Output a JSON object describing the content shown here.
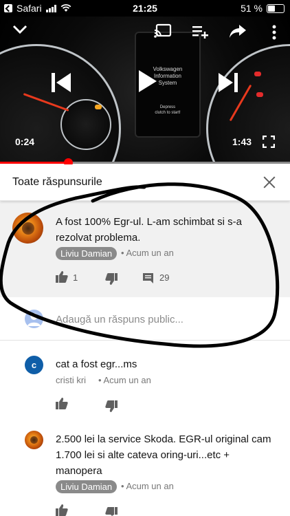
{
  "status_bar": {
    "back_app": "Safari",
    "time": "21:25",
    "battery": "51 %",
    "battery_level": 0.51
  },
  "video": {
    "current_time": "0:24",
    "duration": "1:43",
    "progress": 0.235,
    "screen_text": [
      "Volkswagen",
      "Information",
      "System"
    ],
    "screen_subtext": [
      "Depress",
      "clutch to start!"
    ]
  },
  "replies_panel": {
    "title": "Toate răspunsurile"
  },
  "parent_comment": {
    "text_line1": "A fost 100% Egr-ul. L-am schimbat si s-a",
    "text_line2": "rezolvat problema.",
    "author": "Liviu Damian",
    "time": "• Acum un an",
    "likes": "1",
    "replies": "29"
  },
  "reply_box": {
    "placeholder": "Adaugă un răspuns public..."
  },
  "replies": [
    {
      "avatar_letter": "c",
      "text": "cat a fost egr...ms",
      "author": "cristi kri",
      "time": "• Acum un an"
    },
    {
      "text_line1": "2.500 lei la service Skoda. EGR-ul original cam",
      "text_line2": "1.700 lei si alte cateva oring-uri...etc +",
      "text_line3": "manopera",
      "author": "Liviu Damian",
      "time": "• Acum un an"
    }
  ]
}
